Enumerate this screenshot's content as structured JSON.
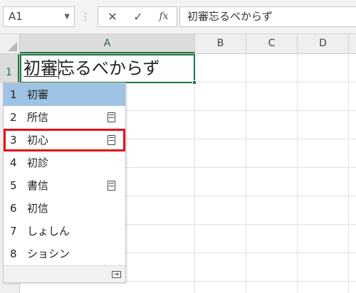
{
  "formula_bar": {
    "name_box": "A1",
    "name_box_dropdown_icon": "chevron-down-icon",
    "cancel_icon": "✕",
    "enter_icon": "✓",
    "fx_label": "fx",
    "formula_text": "初審忘るべからず"
  },
  "columns": [
    "A",
    "B",
    "C",
    "D"
  ],
  "rows": [
    "1"
  ],
  "active_cell": {
    "converting": "初審",
    "rest": "忘るべからず"
  },
  "ime": {
    "candidates": [
      {
        "num": "1",
        "text": "初審"
      },
      {
        "num": "2",
        "text": "所信"
      },
      {
        "num": "3",
        "text": "初心"
      },
      {
        "num": "4",
        "text": "初診"
      },
      {
        "num": "5",
        "text": "書信"
      },
      {
        "num": "6",
        "text": "初信"
      },
      {
        "num": "7",
        "text": "しょしん"
      },
      {
        "num": "8",
        "text": "ショシン"
      }
    ],
    "highlight_color": "#9fc3e4",
    "focus_outline_color": "#e8121b"
  },
  "colors": {
    "accent": "#217346"
  }
}
